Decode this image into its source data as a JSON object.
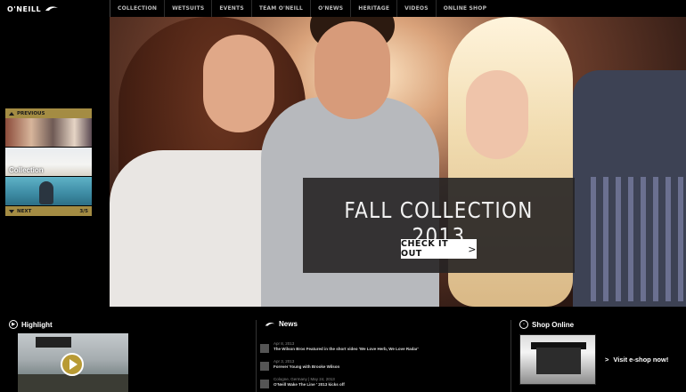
{
  "header": {
    "brand": "O'NEILL",
    "nav": [
      "COLLECTION",
      "WETSUITS",
      "EVENTS",
      "TEAM O'NEILL",
      "O'NEWS",
      "HERITAGE",
      "VIDEOS",
      "ONLINE SHOP"
    ]
  },
  "thumbnails": {
    "previous_label": "PREVIOUS",
    "next_label": "NEXT",
    "counter": "3/5",
    "items": [
      {
        "caption": ""
      },
      {
        "caption": "Collection"
      },
      {
        "caption": ""
      }
    ]
  },
  "hero": {
    "title": "FALL COLLECTION 2013",
    "button_label": "CHECK IT OUT",
    "button_icon": ">"
  },
  "highlight": {
    "title": "Highlight"
  },
  "news": {
    "title": "News",
    "items": [
      {
        "date": "Apr 8, 2013",
        "headline": "The Wilson Bros Featured in the short video 'We Love Herb, We Love Radar'"
      },
      {
        "date": "Apr 3, 2013",
        "headline": "Forever Young with Brooke Wilson"
      },
      {
        "date": "Cologne, Germany | May 24, 2013",
        "headline": "O'Neill Wake The Line ' 2013 kicks off"
      }
    ]
  },
  "shop": {
    "title": "Shop Online",
    "link_label": "Visit e-shop now!",
    "link_icon": ">"
  },
  "colors": {
    "accent": "#a48c43",
    "background": "#000000"
  }
}
